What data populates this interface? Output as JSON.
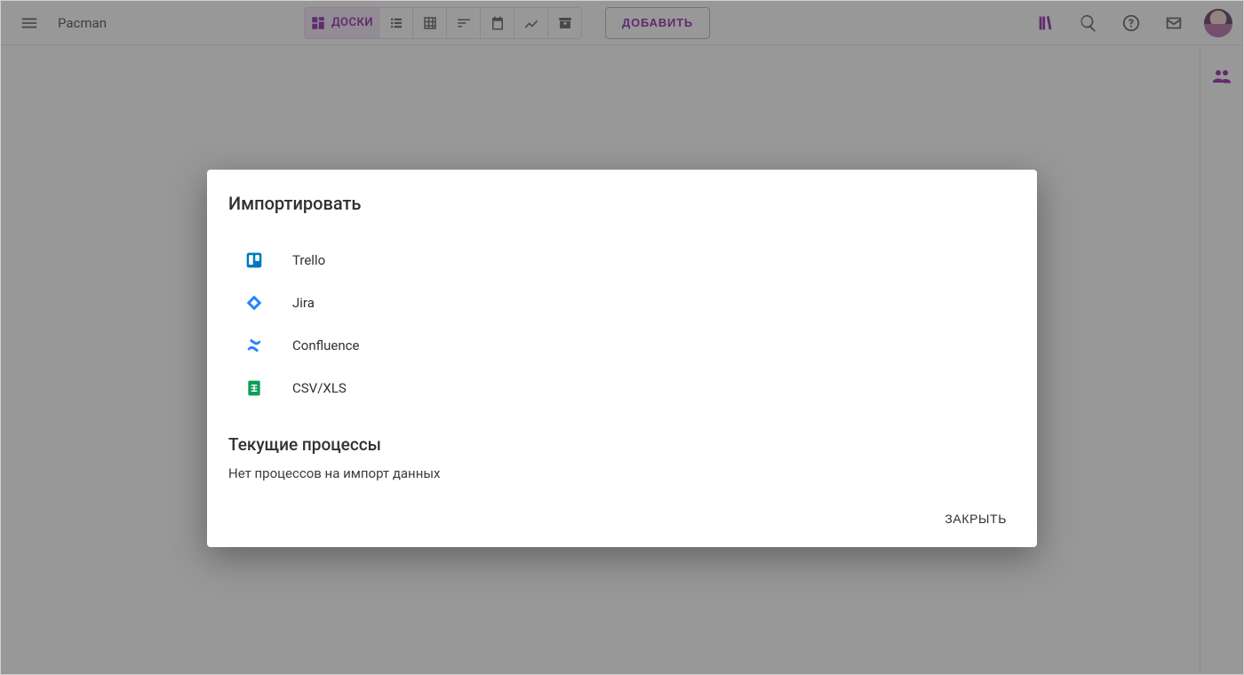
{
  "header": {
    "title": "Pacman",
    "active_view_label": "ДОСКИ",
    "add_label": "ДОБАВИТЬ"
  },
  "dialog": {
    "title": "Импортировать",
    "import_options": [
      {
        "label": "Trello",
        "icon": "trello-icon"
      },
      {
        "label": "Jira",
        "icon": "jira-icon"
      },
      {
        "label": "Confluence",
        "icon": "confluence-icon"
      },
      {
        "label": "CSV/XLS",
        "icon": "sheets-icon"
      }
    ],
    "processes_title": "Текущие процессы",
    "processes_empty": "Нет процессов на импорт данных",
    "close_label": "ЗАКРЫТЬ"
  }
}
